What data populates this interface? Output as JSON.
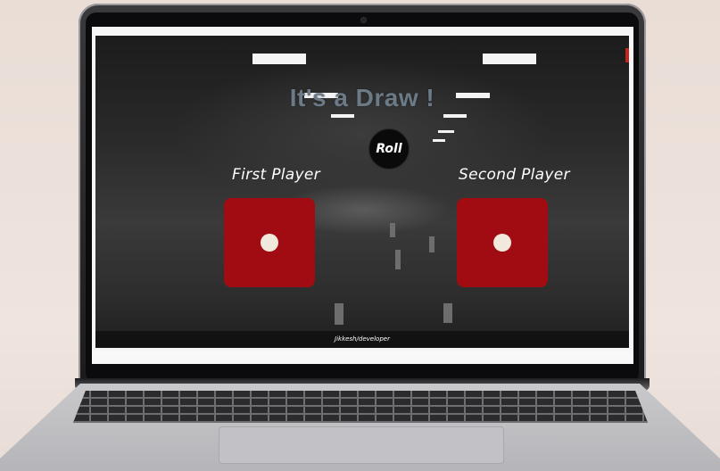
{
  "app": {
    "heading": "It's a Draw !",
    "roll_button_label": "Roll",
    "footer_text": "Jikkesh/developer"
  },
  "players": [
    {
      "label": "First Player",
      "die_value": 1
    },
    {
      "label": "Second Player",
      "die_value": 1
    }
  ],
  "colors": {
    "die": "#a10c12",
    "pip": "#f1e9db",
    "heading": "#6c7a88",
    "roll_button": "#0a0a0a"
  },
  "icons": {
    "die_face": "one-pip-die"
  }
}
